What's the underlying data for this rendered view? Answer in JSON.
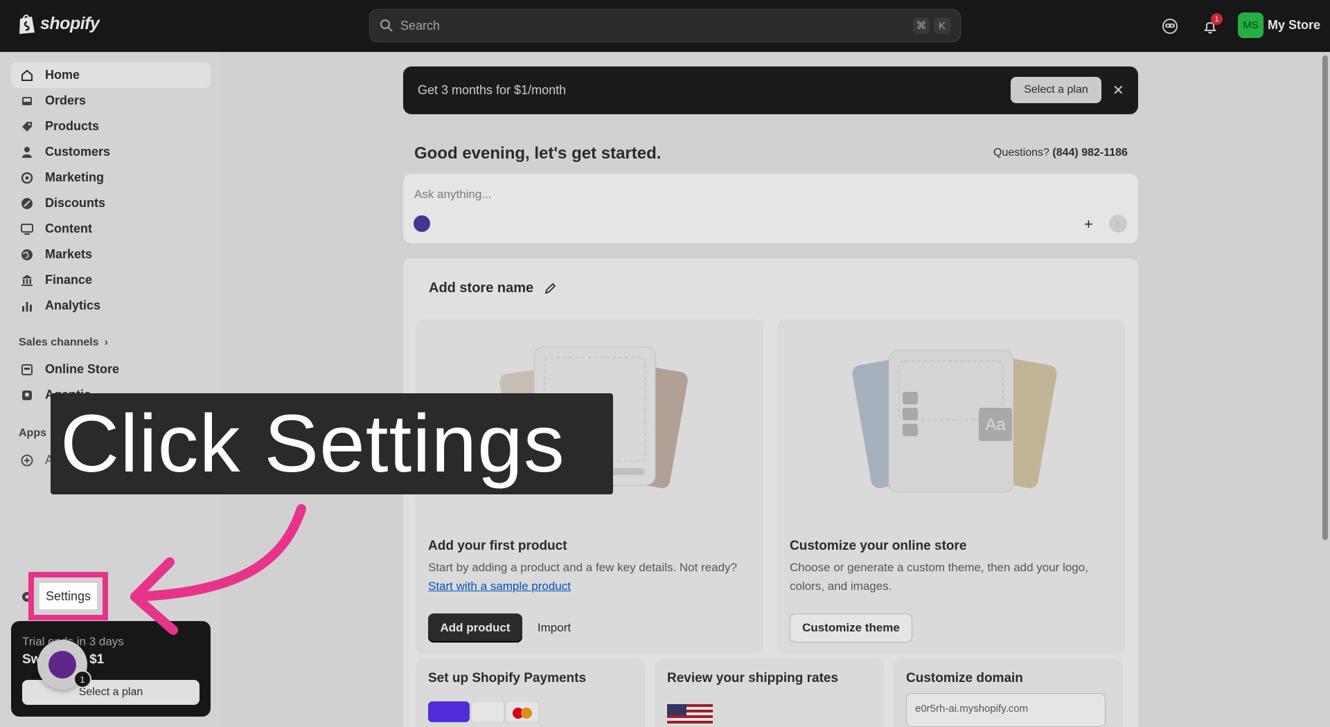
{
  "topbar": {
    "brand": "shopify",
    "search_placeholder": "Search",
    "shortcut_keys": [
      "⌘",
      "K"
    ],
    "notification_count": "1",
    "store_initials": "MS",
    "store_name": "My Store"
  },
  "sidebar": {
    "items": [
      {
        "label": "Home",
        "icon": "home-icon"
      },
      {
        "label": "Orders",
        "icon": "inbox-icon"
      },
      {
        "label": "Products",
        "icon": "tag-icon"
      },
      {
        "label": "Customers",
        "icon": "person-icon"
      },
      {
        "label": "Marketing",
        "icon": "target-icon"
      },
      {
        "label": "Discounts",
        "icon": "discount-icon"
      },
      {
        "label": "Content",
        "icon": "content-icon"
      },
      {
        "label": "Markets",
        "icon": "globe-icon"
      },
      {
        "label": "Finance",
        "icon": "bank-icon"
      },
      {
        "label": "Analytics",
        "icon": "bar-chart-icon"
      }
    ],
    "sales_channels_label": "Sales channels",
    "channels": [
      {
        "label": "Online Store",
        "icon": "store-icon"
      },
      {
        "label": "Agentic",
        "icon": "agent-icon"
      }
    ],
    "apps_label": "Apps",
    "add_apps_label": "Ad",
    "trial": {
      "line1": "Trial ends in 3 days",
      "line2": "Switch for $1",
      "button": "Select a plan"
    },
    "chat_badge": "1"
  },
  "main": {
    "promo": {
      "text": "Get 3 months for $1/month",
      "button": "Select a plan",
      "close": "✕"
    },
    "greeting": "Good evening, let's get started.",
    "questions_label": "Questions?",
    "questions_phone": "(844) 982-1186",
    "ask_placeholder": "Ask anything...",
    "setup": {
      "store_name_label": "Add store name",
      "task1": {
        "title": "Add your first product",
        "desc": "Start by adding a product and a few key details. Not ready?",
        "link": "Start with a sample product",
        "primary": "Add product",
        "secondary": "Import"
      },
      "task2": {
        "title": "Customize your online store",
        "desc": "Choose or generate a custom theme, then add your logo, colors, and images.",
        "button": "Customize theme",
        "font_sample": "Aa"
      },
      "mini": [
        {
          "title": "Set up Shopify Payments"
        },
        {
          "title": "Review your shipping rates"
        },
        {
          "title": "Customize domain",
          "domain": "e0r5rh-ai.myshopify.com"
        }
      ]
    }
  },
  "overlay": {
    "callout": "Click Settings",
    "settings_label": "Settings",
    "accent": "#e8338a"
  }
}
